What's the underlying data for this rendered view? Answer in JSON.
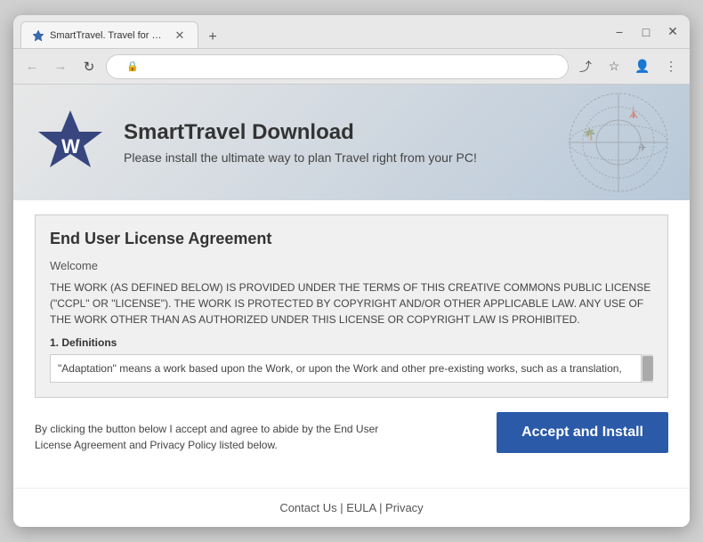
{
  "browser": {
    "tab_label": "SmartTravel. Travel for PC.",
    "new_tab_label": "+",
    "nav_back": "←",
    "nav_forward": "→",
    "nav_refresh": "↻",
    "window_minimize": "−",
    "window_restore": "□",
    "window_close": "✕"
  },
  "toolbar": {
    "share_icon": "share-icon",
    "star_icon": "bookmark-icon",
    "profile_icon": "profile-icon",
    "menu_icon": "menu-icon"
  },
  "hero": {
    "title": "SmartTravel Download",
    "subtitle": "Please install the ultimate way to plan Travel right from your PC!"
  },
  "eula": {
    "title": "End User License Agreement",
    "welcome_label": "Welcome",
    "body_text": "THE WORK (AS DEFINED BELOW) IS PROVIDED UNDER THE TERMS OF THIS CREATIVE COMMONS PUBLIC LICENSE (\"CCPL\" OR \"LICENSE\"). THE WORK IS PROTECTED BY COPYRIGHT AND/OR OTHER APPLICABLE LAW. ANY USE OF THE WORK OTHER THAN AS AUTHORIZED UNDER THIS LICENSE OR COPYRIGHT LAW IS PROHIBITED.",
    "definitions_title": "1. Definitions",
    "definitions_body": "\"Adaptation\" means a work based upon the Work, or upon the Work and other pre-existing works, such as a translation,",
    "accept_text": "By clicking the button below I accept and agree to abide by the End User License Agreement and Privacy Policy listed below.",
    "accept_btn": "Accept and Install"
  },
  "footer": {
    "links": "Contact Us | EULA | Privacy"
  }
}
